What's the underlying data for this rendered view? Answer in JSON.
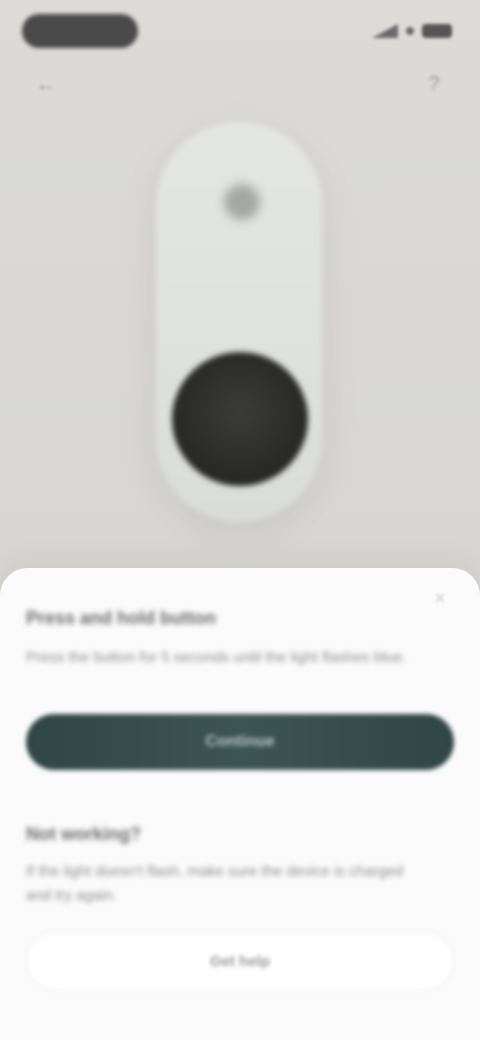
{
  "status_bar": {
    "time": "",
    "icons": [
      "signal-icon",
      "wifi-icon",
      "battery-icon"
    ]
  },
  "nav": {
    "back_icon": "arrow-left-icon",
    "help_icon": "help-icon"
  },
  "device": {
    "body_color": "#e0e2df",
    "button_color": "#2c2c2b"
  },
  "sheet": {
    "close_icon": "close-icon",
    "section1": {
      "title": "Press and hold button",
      "body": "Press the button for 5 seconds until the light flashes blue.",
      "button_label": "Continue"
    },
    "section2": {
      "title": "Not working?",
      "body": "If the light doesn't flash, make sure the device is charged and try again.",
      "button_label": "Get help"
    }
  },
  "colors": {
    "primary_button": "#34504e",
    "sheet_background": "#fbfbfb",
    "screen_background": "#d9d8d5"
  }
}
